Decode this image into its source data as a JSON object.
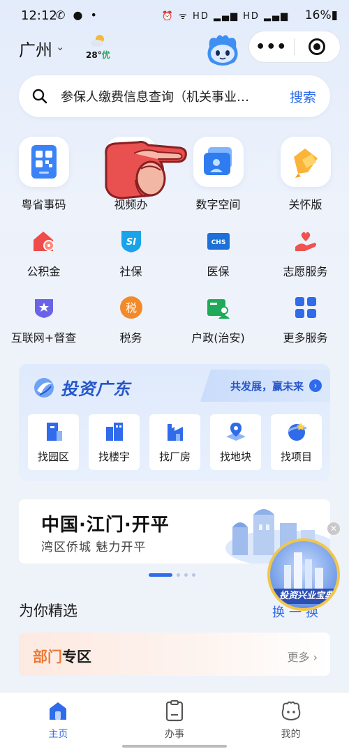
{
  "status_bar": {
    "time": "12:12",
    "left_icons": "✆ ● •",
    "right_icons": "⏰ ᯤ HD ▂▄▆ HD ▂▄▆",
    "battery": "16%▮"
  },
  "header": {
    "city": "广州",
    "weather_temp": "28°",
    "weather_aqi": "优"
  },
  "search": {
    "text": "参保人缴费信息查询（机关事业…",
    "button": "搜索"
  },
  "big_apps": [
    {
      "label": "粤省事码",
      "icon": "qr-code-icon"
    },
    {
      "label": "视频办",
      "icon": "video-icon"
    },
    {
      "label": "数字空间",
      "icon": "folder-icon"
    },
    {
      "label": "关怀版",
      "icon": "ribbon-icon"
    }
  ],
  "grid": [
    {
      "label": "公积金",
      "icon": "house-fund-icon"
    },
    {
      "label": "社保",
      "icon": "social-security-icon",
      "badge": "SI"
    },
    {
      "label": "医保",
      "icon": "medical-insurance-icon",
      "badge": "CHS"
    },
    {
      "label": "志愿服务",
      "icon": "volunteer-heart-icon"
    },
    {
      "label": "互联网+督查",
      "icon": "star-shield-icon"
    },
    {
      "label": "税务",
      "icon": "tax-icon",
      "badge": "税"
    },
    {
      "label": "户政(治安)",
      "icon": "household-icon"
    },
    {
      "label": "更多服务",
      "icon": "more-grid-icon"
    }
  ],
  "invest": {
    "title": "投资广东",
    "slogan": "共发展，赢未来",
    "items": [
      "找园区",
      "找楼宇",
      "找厂房",
      "找地块",
      "找项目"
    ]
  },
  "banner": {
    "headline": "中国·江门·开平",
    "subline": "湾区侨城 魅力开平"
  },
  "float_ad": {
    "label": "投资兴业宝典"
  },
  "section": {
    "title": "为你精选",
    "refresh": "换一换"
  },
  "dept": {
    "title_highlight": "部门",
    "title_rest": "专区",
    "more": "更多 ›"
  },
  "tabbar": [
    {
      "label": "主页",
      "active": true
    },
    {
      "label": "办事",
      "active": false
    },
    {
      "label": "我的",
      "active": false
    }
  ],
  "colors": {
    "primary": "#2f6bea",
    "invest_title": "#2657c9",
    "dept_highlight": "#ec7b3a",
    "aqi_good": "#2aa65a"
  }
}
